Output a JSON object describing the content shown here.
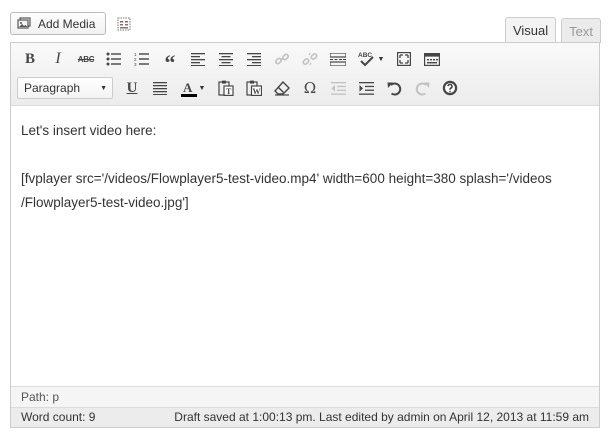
{
  "media": {
    "add_media_label": "Add Media"
  },
  "tabs": {
    "visual": "Visual",
    "text": "Text"
  },
  "toolbar": {
    "format_select_value": "Paragraph",
    "bold_glyph": "B",
    "italic_glyph": "I",
    "strike_glyph": "ABC",
    "underline_glyph": "U",
    "omega_glyph": "Ω",
    "blockquote_glyph": "“",
    "spellcheck_glyph": "ABC",
    "textcolor_glyph": "A"
  },
  "content": {
    "line1": "Let's insert video here:",
    "line2": "[fvplayer src='/videos/Flowplayer5-test-video.mp4' width=600 height=380 splash='/videos",
    "line3": "/Flowplayer5-test-video.jpg']"
  },
  "path_bar": {
    "text": "Path: p"
  },
  "status": {
    "word_count": "Word count: 9",
    "draft_saved": "Draft saved at 1:00:13 pm. Last edited by admin on April 12, 2013 at 11:59 am"
  },
  "colors": {
    "accent_textcolor": "#000000",
    "icon": "#464646",
    "disabled": "#c2c2c2"
  }
}
